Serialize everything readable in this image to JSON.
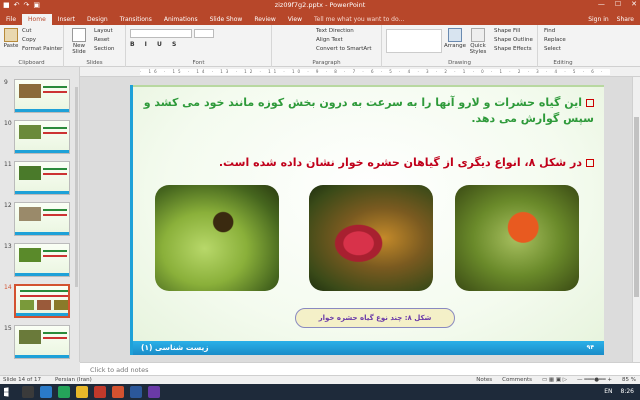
{
  "window": {
    "title": "ziz09f7g2.pptx - PowerPoint",
    "controls": [
      "—",
      "☐",
      "✕"
    ]
  },
  "qat": [
    "■",
    "↶",
    "↷",
    "▣"
  ],
  "tabs": [
    "File",
    "Home",
    "Insert",
    "Design",
    "Transitions",
    "Animations",
    "Slide Show",
    "Review",
    "View"
  ],
  "active_tab": "Home",
  "tell_me": "Tell me what you want to do...",
  "account": {
    "sign_in": "Sign in",
    "share": "Share"
  },
  "ribbon": {
    "clipboard": {
      "paste": "Paste",
      "cut": "Cut",
      "copy": "Copy",
      "format_painter": "Format Painter",
      "label": "Clipboard"
    },
    "slides": {
      "new_slide": "New Slide",
      "layout": "Layout",
      "reset": "Reset",
      "section": "Section",
      "label": "Slides"
    },
    "font": {
      "label": "Font"
    },
    "paragraph": {
      "text_direction": "Text Direction",
      "align_text": "Align Text",
      "smartart": "Convert to SmartArt",
      "label": "Paragraph"
    },
    "drawing": {
      "arrange": "Arrange",
      "quick_styles": "Quick Styles",
      "shape_fill": "Shape Fill",
      "shape_outline": "Shape Outline",
      "shape_effects": "Shape Effects",
      "label": "Drawing"
    },
    "editing": {
      "find": "Find",
      "replace": "Replace",
      "select": "Select",
      "label": "Editing"
    }
  },
  "ruler_text": "· 16 · 15 · 14 · 13 · 12 · 11 · 10 · 9 · 8 · 7 · 6 · 5 · 4 · 3 · 2 · 1 · 0 · 1 · 2 · 3 · 4 · 5 · 6 · 7 · 8 · 9 · 10 · 11 · 12 · 13 · 14 · 15 · 16 ·",
  "thumbnails": [
    {
      "num": "9"
    },
    {
      "num": "10"
    },
    {
      "num": "11"
    },
    {
      "num": "12"
    },
    {
      "num": "13"
    },
    {
      "num": "14"
    },
    {
      "num": "15"
    }
  ],
  "active_slide": "14",
  "slide": {
    "para1": "این گیاه حشرات و لارو آنها را به سرعت به درون بخش کوزه مانند خود می کشد و سپس گوارش می دهد.",
    "para2": "در شکل ۸، انواع دیگری از گیاهان حشره خوار نشان داده شده است.",
    "caption": "شکل ۸: چند نوع گیاه حشره خوار",
    "footer_title": "زیست شناسی (۱)",
    "page_number": "۹۴",
    "accent": "#1ea1d8",
    "para1_color": "#2e9a3a",
    "para2_color": "#c0001a"
  },
  "notes_placeholder": "Click to add notes",
  "status": {
    "slide_info": "Slide 14 of 17",
    "language": "Persian (Iran)",
    "notes": "Notes",
    "comments": "Comments",
    "zoom": "85 %"
  },
  "taskbar": {
    "lang": "EN",
    "time": "8:26"
  }
}
